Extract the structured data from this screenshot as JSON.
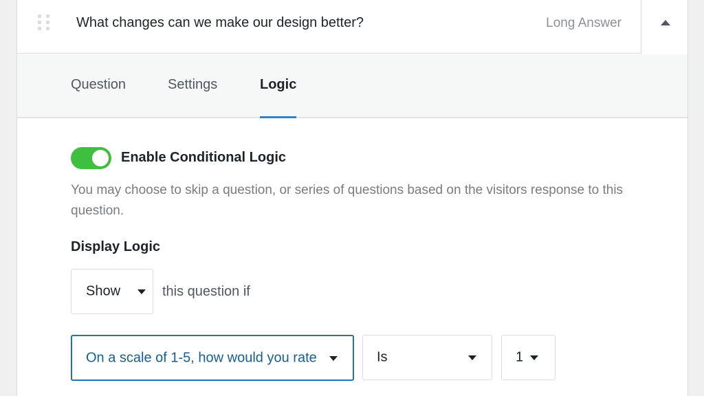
{
  "question": {
    "title": "What changes can we make our design better?",
    "type": "Long Answer"
  },
  "tabs": [
    {
      "label": "Question",
      "active": false
    },
    {
      "label": "Settings",
      "active": false
    },
    {
      "label": "Logic",
      "active": true
    }
  ],
  "logic": {
    "toggle_label": "Enable Conditional Logic",
    "toggle_on": true,
    "description": "You may choose to skip a question, or series of questions based on the visitors response to this question.",
    "section_title": "Display Logic",
    "action_value": "Show",
    "action_suffix": "this question if",
    "condition_question": "On a scale of 1-5, how would you rate",
    "condition_operator": "Is",
    "condition_value": "1"
  },
  "colors": {
    "toggle_on": "#3fbf3f",
    "accent": "#3582c4",
    "focus_border": "#2271b1"
  }
}
